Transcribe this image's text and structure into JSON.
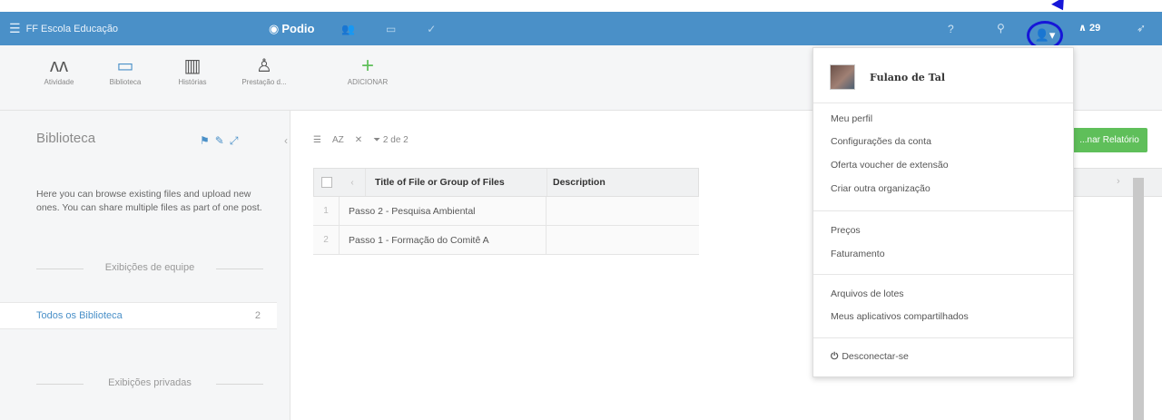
{
  "topbar": {
    "brand": "FF Escola Educação",
    "podio": "Podio",
    "help": "?",
    "notifications": "29",
    "menu_icon": "hamburger-icon",
    "user_icon": "user-icon"
  },
  "apps": [
    {
      "label": "Atividade",
      "icon": "activity-icon",
      "glyph": "ʌʌ"
    },
    {
      "label": "Biblioteca",
      "icon": "folder-icon",
      "glyph": "▭"
    },
    {
      "label": "Histórias",
      "icon": "book-icon",
      "glyph": "▥"
    },
    {
      "label": "Prestação d...",
      "icon": "money-bag-icon",
      "glyph": "♙"
    },
    {
      "label": "ADICIONAR",
      "icon": "add-icon",
      "glyph": "+"
    }
  ],
  "sidebar": {
    "title": "Biblioteca",
    "description": "Here you can browse existing files and upload new ones. You can share multiple files as part of one post.",
    "team_views_label": "Exibições de equipe",
    "view_label": "Todos os Biblioteca",
    "view_count": "2",
    "private_views_label": "Exibições privadas"
  },
  "toolbar": {
    "sort": "AZ",
    "filter_count": "2 de 2"
  },
  "table": {
    "columns": [
      "Title of File or Group of Files",
      "Description"
    ],
    "rows": [
      {
        "num": "1",
        "title": "Passo 2 - Pesquisa Ambiental",
        "description": ""
      },
      {
        "num": "2",
        "title": "Passo 1 - Formação do Comitê A",
        "description": ""
      }
    ]
  },
  "report_button": "...nar Relatório",
  "dropdown": {
    "user_name": "Fulano de Tal",
    "section1": [
      "Meu perfil",
      "Configurações da conta",
      "Oferta voucher de extensão",
      "Criar outra organização"
    ],
    "section2": [
      "Preços",
      "Faturamento"
    ],
    "section3": [
      "Arquivos de lotes",
      "Meus aplicativos compartilhados"
    ],
    "logout": "Desconectar-se"
  },
  "colors": {
    "topbar": "#4a90c8",
    "accent": "#4a90c8",
    "green": "#5fbf5a",
    "highlight_circle": "#1616d8"
  }
}
